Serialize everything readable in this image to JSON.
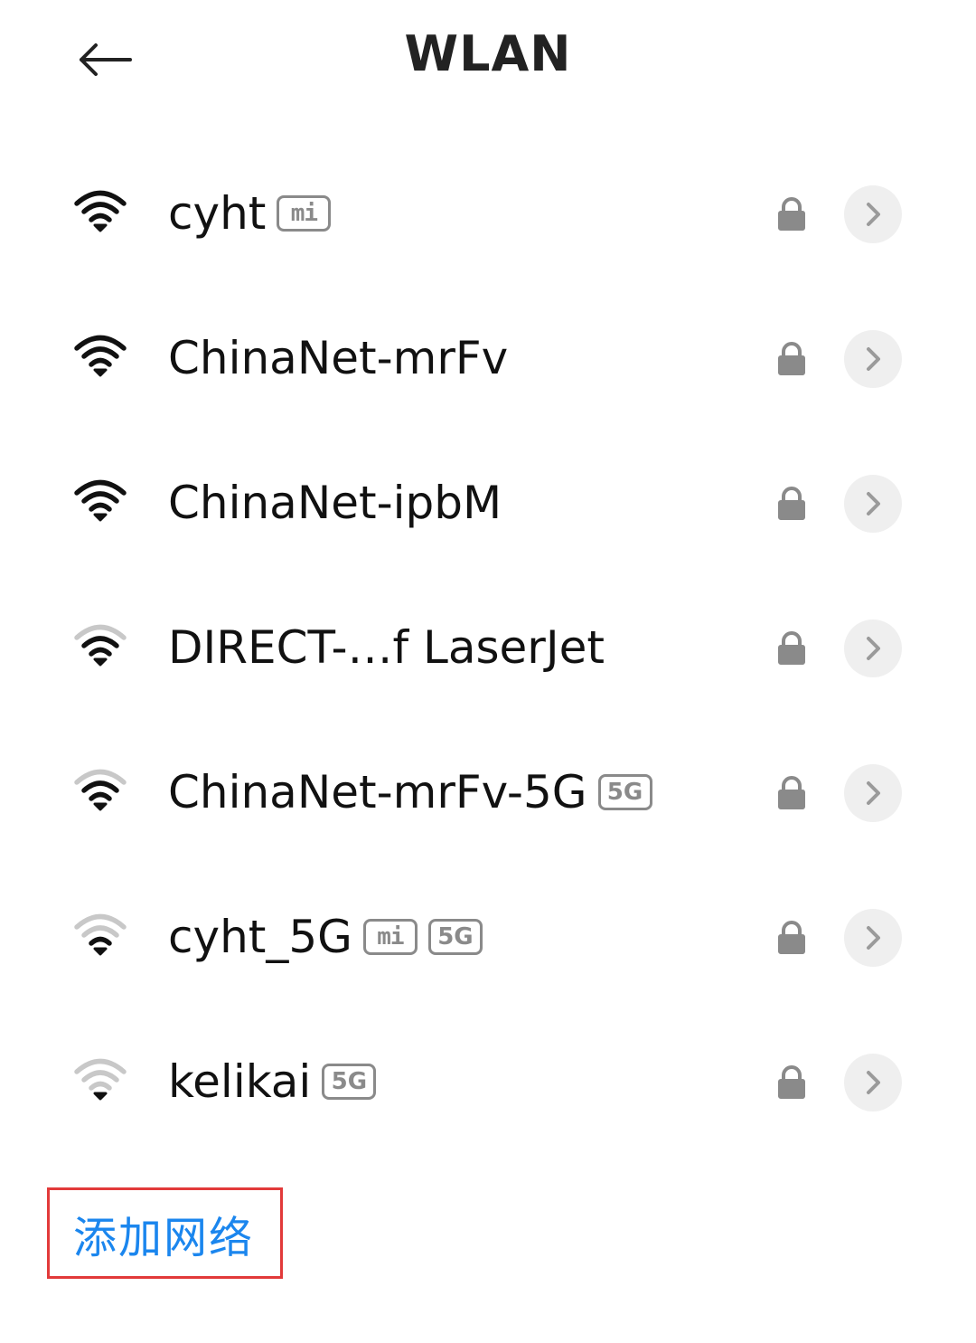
{
  "header": {
    "title": "WLAN",
    "back_icon": "arrow-left-icon"
  },
  "networks": [
    {
      "name": "cyht",
      "signal_level": 4,
      "badges": [
        "mi"
      ],
      "secured": true
    },
    {
      "name": "ChinaNet-mrFv",
      "signal_level": 4,
      "badges": [],
      "secured": true
    },
    {
      "name": "ChinaNet-ipbM",
      "signal_level": 4,
      "badges": [],
      "secured": true
    },
    {
      "name": "DIRECT-…f LaserJet",
      "signal_level": 3,
      "badges": [],
      "secured": true
    },
    {
      "name": "ChinaNet-mrFv-5G",
      "signal_level": 3,
      "badges": [
        "5G"
      ],
      "secured": true
    },
    {
      "name": "cyht_5G",
      "signal_level": 2,
      "badges": [
        "mi",
        "5G"
      ],
      "secured": true
    },
    {
      "name": "kelikai",
      "signal_level": 1,
      "badges": [
        "5G"
      ],
      "secured": true
    }
  ],
  "badge_labels": {
    "mi": "mi",
    "5G": "5G"
  },
  "add_network": {
    "label": "添加网络"
  },
  "colors": {
    "accent": "#1b86ee",
    "highlight_box": "#e23a3a",
    "signal_on": "#111111",
    "signal_off": "#c8c8c8",
    "icon_gray": "#8a8a8a"
  }
}
